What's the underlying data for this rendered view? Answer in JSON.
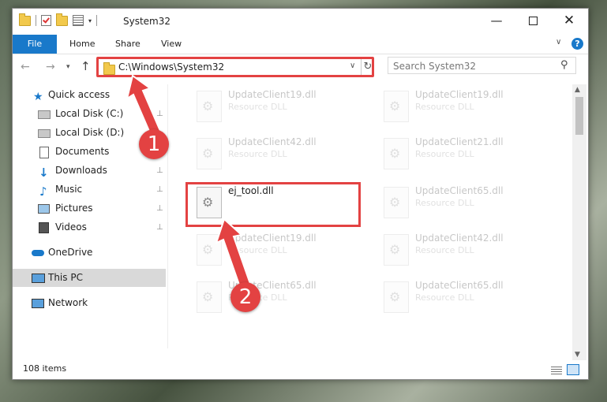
{
  "window": {
    "title": "System32",
    "controls": {
      "minimize": "—",
      "maximize": "",
      "close": "✕"
    }
  },
  "ribbon": {
    "tabs": [
      "File",
      "Home",
      "Share",
      "View"
    ],
    "chevron": "∨",
    "help": "?"
  },
  "navigation": {
    "back": "←",
    "forward": "→",
    "recent": "▾",
    "up": "↑",
    "address": "C:\\Windows\\System32",
    "address_dropdown": "∨",
    "refresh": "↻",
    "search_placeholder": "Search System32",
    "search_icon": "⚲"
  },
  "sidebar": {
    "items": [
      {
        "label": "Quick access",
        "icon": "star-icon",
        "pinned": false
      },
      {
        "label": "Local Disk (C:)",
        "icon": "drive-icon",
        "pinned": true
      },
      {
        "label": "Local Disk (D:)",
        "icon": "drive-icon",
        "pinned": false
      },
      {
        "label": "Documents",
        "icon": "documents-icon",
        "pinned": false
      },
      {
        "label": "Downloads",
        "icon": "download-icon",
        "pinned": true
      },
      {
        "label": "Music",
        "icon": "music-icon",
        "pinned": true
      },
      {
        "label": "Pictures",
        "icon": "pictures-icon",
        "pinned": true
      },
      {
        "label": "Videos",
        "icon": "videos-icon",
        "pinned": true
      },
      {
        "label": "OneDrive",
        "icon": "cloud-icon",
        "pinned": false
      },
      {
        "label": "This PC",
        "icon": "computer-icon",
        "pinned": false,
        "selected": true
      },
      {
        "label": "Network",
        "icon": "network-icon",
        "pinned": false
      }
    ],
    "pin_glyph": "📌"
  },
  "files": {
    "left_column": [
      {
        "name": "UpdateClient19.dll",
        "type": "Resource DLL",
        "faded": true
      },
      {
        "name": "UpdateClient42.dll",
        "type": "Resource DLL",
        "faded": true
      },
      {
        "name": "ej_tool.dll",
        "type": "",
        "faded": false,
        "highlighted": true
      },
      {
        "name": "UpdateClient19.dll",
        "type": "Resource DLL",
        "faded": true
      },
      {
        "name": "UpdateClient65.dll",
        "type": "Resource DLL",
        "faded": true
      }
    ],
    "right_column": [
      {
        "name": "UpdateClient19.dll",
        "type": "Resource DLL",
        "faded": true
      },
      {
        "name": "UpdateClient21.dll",
        "type": "Resource DLL",
        "faded": true
      },
      {
        "name": "UpdateClient65.dll",
        "type": "Resource DLL",
        "faded": true
      },
      {
        "name": "UpdateClient42.dll",
        "type": "Resource DLL",
        "faded": true
      },
      {
        "name": "UpdateClient65.dll",
        "type": "Resource DLL",
        "faded": true
      }
    ]
  },
  "status": {
    "item_count": "108 items"
  },
  "annotations": {
    "step1": "1",
    "step2": "2",
    "color": "#e34242"
  },
  "colors": {
    "accent": "#1979ca",
    "highlight": "#e34242"
  }
}
